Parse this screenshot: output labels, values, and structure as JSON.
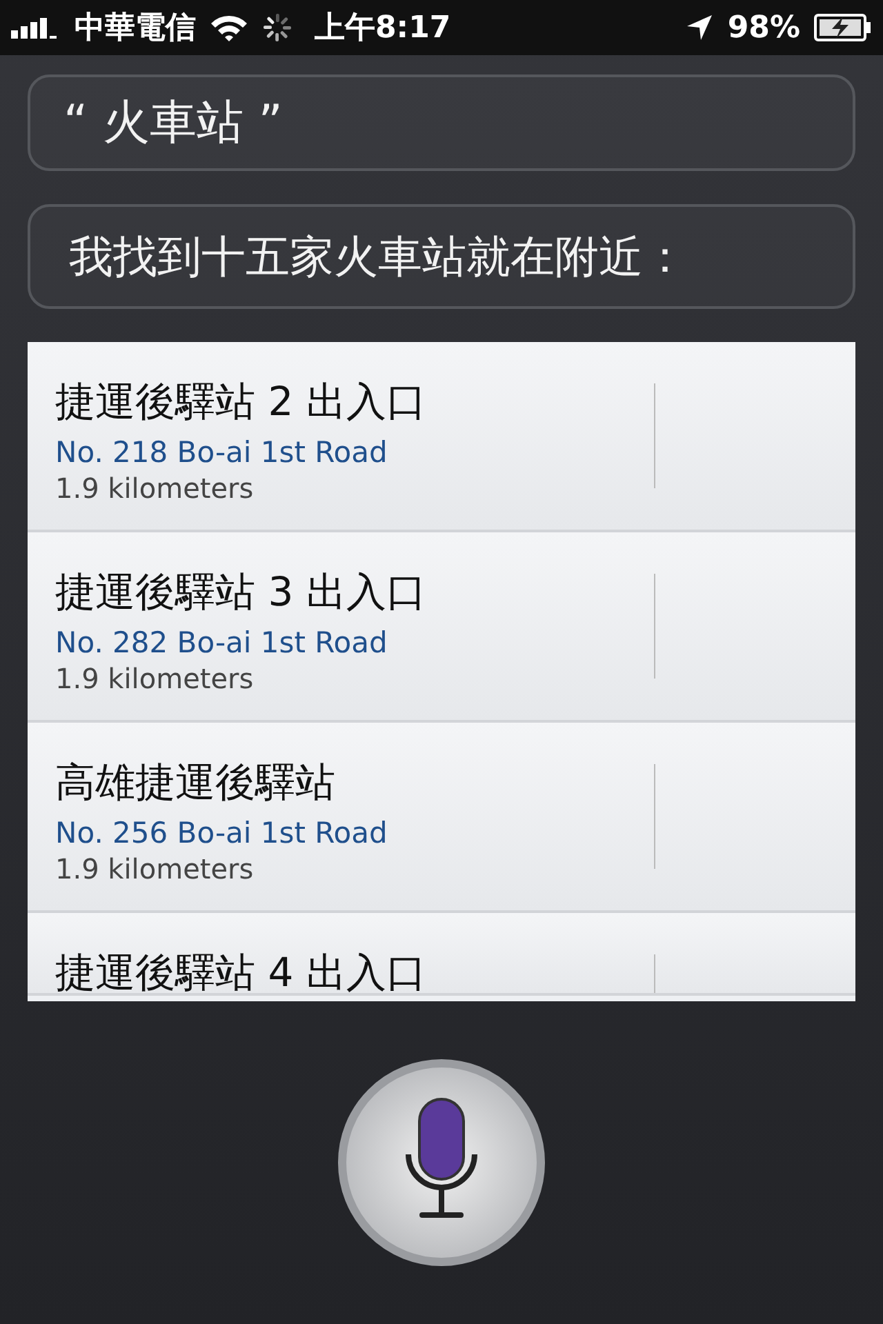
{
  "status_bar": {
    "carrier": "中華電信",
    "time": "上午8:17",
    "battery": "98%"
  },
  "user_query": "“ 火車站 ”",
  "assistant_reply": "我找到十五家火車站就在附近：",
  "results": [
    {
      "title": "捷運後驛站 2 出入口",
      "address": "No. 218 Bo-ai 1st Road",
      "distance": "1.9 kilometers"
    },
    {
      "title": "捷運後驛站 3 出入口",
      "address": "No. 282 Bo-ai 1st Road",
      "distance": "1.9 kilometers"
    },
    {
      "title": "高雄捷運後驛站",
      "address": "No. 256 Bo-ai 1st Road",
      "distance": "1.9 kilometers"
    },
    {
      "title": "捷運後驛站 4 出入口"
    }
  ]
}
